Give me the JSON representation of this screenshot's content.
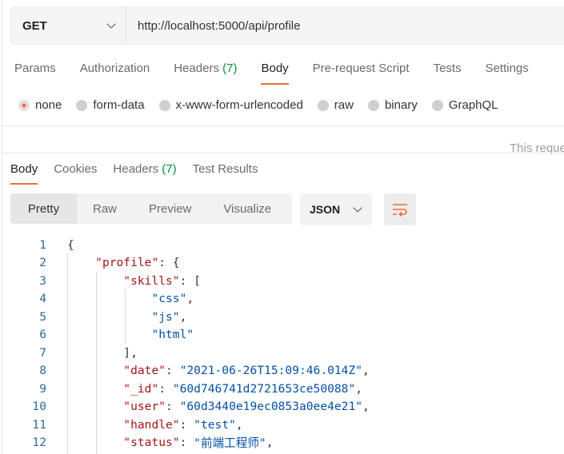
{
  "request": {
    "method": "GET",
    "url": "http://localhost:5000/api/profile"
  },
  "tabs": [
    {
      "label": "Params"
    },
    {
      "label": "Authorization"
    },
    {
      "label": "Headers",
      "count": "(7)"
    },
    {
      "label": "Body"
    },
    {
      "label": "Pre-request Script"
    },
    {
      "label": "Tests"
    },
    {
      "label": "Settings"
    }
  ],
  "body_types": [
    {
      "label": "none",
      "selected": true
    },
    {
      "label": "form-data"
    },
    {
      "label": "x-www-form-urlencoded"
    },
    {
      "label": "raw"
    },
    {
      "label": "binary"
    },
    {
      "label": "GraphQL"
    }
  ],
  "note": "This reque",
  "response_tabs": [
    {
      "label": "Body"
    },
    {
      "label": "Cookies"
    },
    {
      "label": "Headers",
      "count": "(7)"
    },
    {
      "label": "Test Results"
    }
  ],
  "view_modes": [
    "Pretty",
    "Raw",
    "Preview",
    "Visualize"
  ],
  "format": "JSON",
  "accent": "#f26b3a",
  "code_lines": [
    [
      [
        "p",
        "{"
      ]
    ],
    [
      [
        "p",
        "    "
      ],
      [
        "k",
        "\"profile\""
      ],
      [
        "p",
        ": {"
      ]
    ],
    [
      [
        "p",
        "        "
      ],
      [
        "k",
        "\"skills\""
      ],
      [
        "p",
        ": ["
      ]
    ],
    [
      [
        "p",
        "            "
      ],
      [
        "s",
        "\"css\""
      ],
      [
        "p",
        ","
      ]
    ],
    [
      [
        "p",
        "            "
      ],
      [
        "s",
        "\"js\""
      ],
      [
        "p",
        ","
      ]
    ],
    [
      [
        "p",
        "            "
      ],
      [
        "s",
        "\"html\""
      ]
    ],
    [
      [
        "p",
        "        ],"
      ]
    ],
    [
      [
        "p",
        "        "
      ],
      [
        "k",
        "\"date\""
      ],
      [
        "p",
        ": "
      ],
      [
        "s",
        "\"2021-06-26T15:09:46.014Z\""
      ],
      [
        "p",
        ","
      ]
    ],
    [
      [
        "p",
        "        "
      ],
      [
        "k",
        "\"_id\""
      ],
      [
        "p",
        ": "
      ],
      [
        "s",
        "\"60d746741d2721653ce50088\""
      ],
      [
        "p",
        ","
      ]
    ],
    [
      [
        "p",
        "        "
      ],
      [
        "k",
        "\"user\""
      ],
      [
        "p",
        ": "
      ],
      [
        "s",
        "\"60d3440e19ec0853a0ee4e21\""
      ],
      [
        "p",
        ","
      ]
    ],
    [
      [
        "p",
        "        "
      ],
      [
        "k",
        "\"handle\""
      ],
      [
        "p",
        ": "
      ],
      [
        "s",
        "\"test\""
      ],
      [
        "p",
        ","
      ]
    ],
    [
      [
        "p",
        "        "
      ],
      [
        "k",
        "\"status\""
      ],
      [
        "p",
        ": "
      ],
      [
        "s",
        "\"前端工程师\""
      ],
      [
        "p",
        ","
      ]
    ]
  ]
}
